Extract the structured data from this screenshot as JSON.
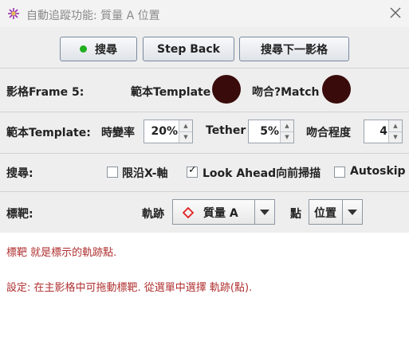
{
  "window": {
    "title": "自動追蹤功能: 質量 A 位置"
  },
  "toolbar": {
    "search_label": "搜尋",
    "step_back_label": "Step Back",
    "search_next_label": "搜尋下一影格"
  },
  "frame_row": {
    "frame_label": "影格Frame 5:",
    "template_label": "範本Template",
    "match_label": "吻合?Match",
    "swatch_color": "#3a0b0b"
  },
  "template_row": {
    "label": "範本Template:",
    "evolve_label": "時變率",
    "evolve_value": "20%",
    "tether_label": "Tether",
    "tether_value": "5%",
    "match_label": "吻合程度",
    "match_value": "4"
  },
  "search_row": {
    "label": "搜尋:",
    "x_axis_label": "限沿X-軸",
    "x_axis_checked": false,
    "lookahead_label": "Look Ahead向前掃描",
    "lookahead_checked": true,
    "autoskip_label": "Autoskip",
    "autoskip_checked": false
  },
  "target_row": {
    "label": "標靶:",
    "track_label": "軌跡",
    "track_value": "質量 A",
    "point_label": "點",
    "point_value": "位置",
    "track_icon_color": "#e02020"
  },
  "messages": {
    "line1": "標靶 就是標示的軌跡點.",
    "line2": "設定: 在主影格中可拖動標靶. 從選單中選擇 軌跡(點)."
  }
}
